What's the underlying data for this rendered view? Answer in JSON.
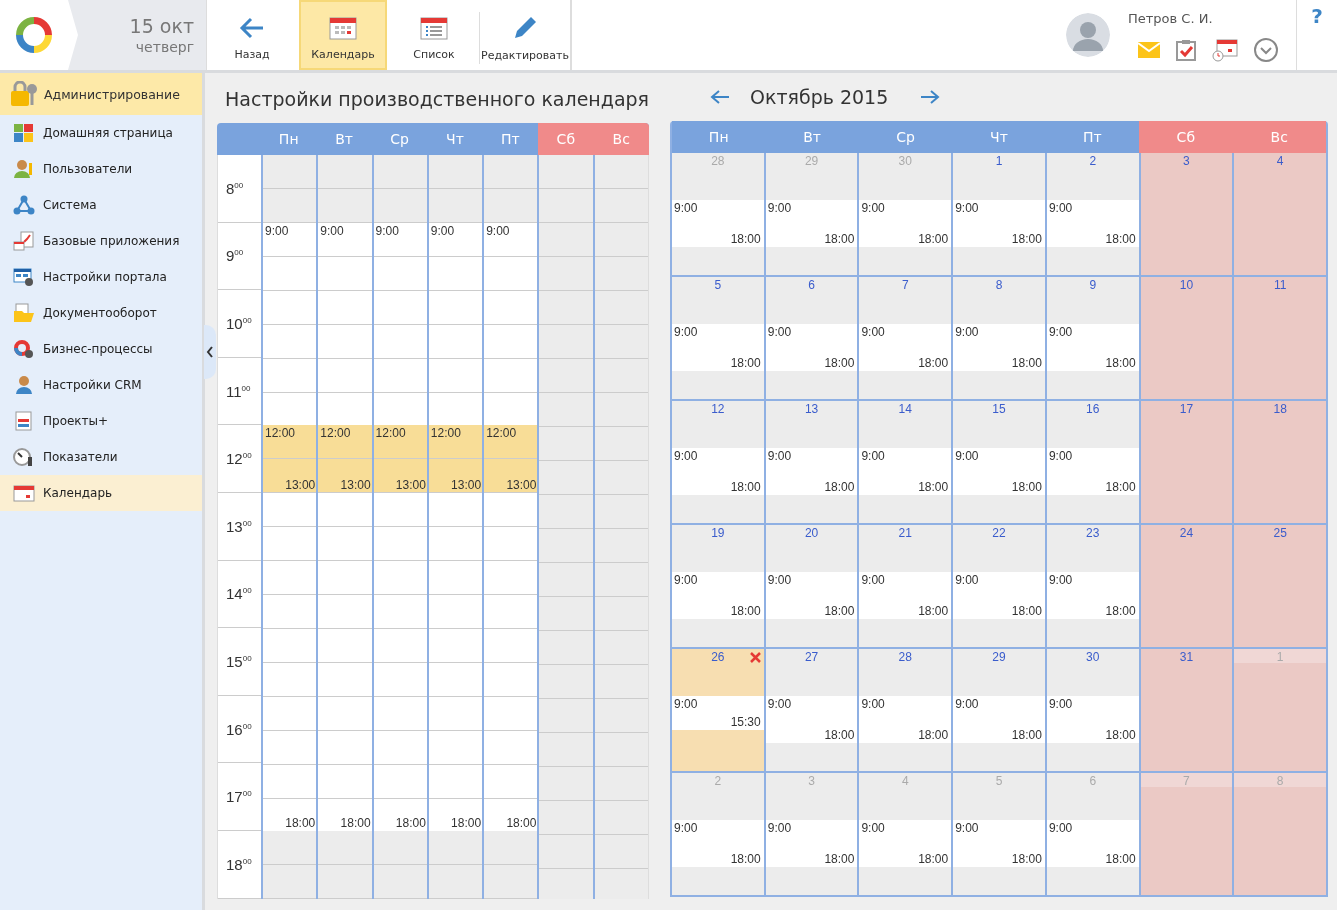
{
  "header": {
    "date": "15 окт",
    "weekday": "четверг",
    "toolbar": [
      {
        "label": "Назад",
        "kind": "back",
        "selected": false
      },
      {
        "label": "Календарь",
        "kind": "calendar",
        "selected": true
      },
      {
        "label": "Список",
        "kind": "list",
        "selected": false
      },
      {
        "label": "Редактировать",
        "kind": "edit",
        "selected": false
      }
    ],
    "user": {
      "name": "Петров С. И."
    },
    "help": "?"
  },
  "sidebar": {
    "section": {
      "label": "Администрирование"
    },
    "items": [
      {
        "label": "Домашняя страница",
        "kind": "home",
        "selected": false
      },
      {
        "label": "Пользователи",
        "kind": "users",
        "selected": false
      },
      {
        "label": "Система",
        "kind": "system",
        "selected": false
      },
      {
        "label": "Базовые приложения",
        "kind": "apps",
        "selected": false
      },
      {
        "label": "Настройки портала",
        "kind": "portal",
        "selected": false
      },
      {
        "label": "Документооборот",
        "kind": "docs",
        "selected": false
      },
      {
        "label": "Бизнес-процессы",
        "kind": "process",
        "selected": false
      },
      {
        "label": "Настройки CRM",
        "kind": "crm",
        "selected": false
      },
      {
        "label": "Проекты+",
        "kind": "projects",
        "selected": false
      },
      {
        "label": "Показатели",
        "kind": "metrics",
        "selected": false
      },
      {
        "label": "Календарь",
        "kind": "calendar",
        "selected": true
      }
    ]
  },
  "title": "Настройки производственного календаря",
  "week": {
    "hours": [
      "8$^{00}$",
      "9$^{00}$",
      "10$^{00}$",
      "11$^{00}$",
      "12$^{00}$",
      "13$^{00}$",
      "14$^{00}$",
      "15$^{00}$",
      "16$^{00}$",
      "17$^{00}$",
      "18$^{00}$"
    ],
    "days": [
      {
        "label": "Пн",
        "weekend": false,
        "start": "9:00",
        "break_start": "12:00",
        "break_end": "13:00",
        "end": "18:00"
      },
      {
        "label": "Вт",
        "weekend": false,
        "start": "9:00",
        "break_start": "12:00",
        "break_end": "13:00",
        "end": "18:00"
      },
      {
        "label": "Ср",
        "weekend": false,
        "start": "9:00",
        "break_start": "12:00",
        "break_end": "13:00",
        "end": "18:00"
      },
      {
        "label": "Чт",
        "weekend": false,
        "start": "9:00",
        "break_start": "12:00",
        "break_end": "13:00",
        "end": "18:00"
      },
      {
        "label": "Пт",
        "weekend": false,
        "start": "9:00",
        "break_start": "12:00",
        "break_end": "13:00",
        "end": "18:00"
      },
      {
        "label": "Сб",
        "weekend": true
      },
      {
        "label": "Вс",
        "weekend": true
      }
    ]
  },
  "month": {
    "title": "Октябрь 2015",
    "weekdays": [
      {
        "label": "Пн",
        "weekend": false
      },
      {
        "label": "Вт",
        "weekend": false
      },
      {
        "label": "Ср",
        "weekend": false
      },
      {
        "label": "Чт",
        "weekend": false
      },
      {
        "label": "Пт",
        "weekend": false
      },
      {
        "label": "Сб",
        "weekend": true
      },
      {
        "label": "Вс",
        "weekend": true
      }
    ],
    "weeks": [
      [
        {
          "day": "28",
          "current": false,
          "weekend": false,
          "changed": false,
          "start": "9:00",
          "end": "18:00"
        },
        {
          "day": "29",
          "current": false,
          "weekend": false,
          "changed": false,
          "start": "9:00",
          "end": "18:00"
        },
        {
          "day": "30",
          "current": false,
          "weekend": false,
          "changed": false,
          "start": "9:00",
          "end": "18:00"
        },
        {
          "day": "1",
          "current": true,
          "weekend": false,
          "changed": false,
          "start": "9:00",
          "end": "18:00"
        },
        {
          "day": "2",
          "current": true,
          "weekend": false,
          "changed": false,
          "start": "9:00",
          "end": "18:00"
        },
        {
          "day": "3",
          "current": true,
          "weekend": true,
          "changed": false
        },
        {
          "day": "4",
          "current": true,
          "weekend": true,
          "changed": false
        }
      ],
      [
        {
          "day": "5",
          "current": true,
          "weekend": false,
          "changed": false,
          "start": "9:00",
          "end": "18:00"
        },
        {
          "day": "6",
          "current": true,
          "weekend": false,
          "changed": false,
          "start": "9:00",
          "end": "18:00"
        },
        {
          "day": "7",
          "current": true,
          "weekend": false,
          "changed": false,
          "start": "9:00",
          "end": "18:00"
        },
        {
          "day": "8",
          "current": true,
          "weekend": false,
          "changed": false,
          "start": "9:00",
          "end": "18:00"
        },
        {
          "day": "9",
          "current": true,
          "weekend": false,
          "changed": false,
          "start": "9:00",
          "end": "18:00"
        },
        {
          "day": "10",
          "current": true,
          "weekend": true,
          "changed": false
        },
        {
          "day": "11",
          "current": true,
          "weekend": true,
          "changed": false
        }
      ],
      [
        {
          "day": "12",
          "current": true,
          "weekend": false,
          "changed": false,
          "start": "9:00",
          "end": "18:00"
        },
        {
          "day": "13",
          "current": true,
          "weekend": false,
          "changed": false,
          "start": "9:00",
          "end": "18:00"
        },
        {
          "day": "14",
          "current": true,
          "weekend": false,
          "changed": false,
          "start": "9:00",
          "end": "18:00"
        },
        {
          "day": "15",
          "current": true,
          "weekend": false,
          "changed": false,
          "start": "9:00",
          "end": "18:00"
        },
        {
          "day": "16",
          "current": true,
          "weekend": false,
          "changed": false,
          "start": "9:00",
          "end": "18:00"
        },
        {
          "day": "17",
          "current": true,
          "weekend": true,
          "changed": false
        },
        {
          "day": "18",
          "current": true,
          "weekend": true,
          "changed": false
        }
      ],
      [
        {
          "day": "19",
          "current": true,
          "weekend": false,
          "changed": false,
          "start": "9:00",
          "end": "18:00"
        },
        {
          "day": "20",
          "current": true,
          "weekend": false,
          "changed": false,
          "start": "9:00",
          "end": "18:00"
        },
        {
          "day": "21",
          "current": true,
          "weekend": false,
          "changed": false,
          "start": "9:00",
          "end": "18:00"
        },
        {
          "day": "22",
          "current": true,
          "weekend": false,
          "changed": false,
          "start": "9:00",
          "end": "18:00"
        },
        {
          "day": "23",
          "current": true,
          "weekend": false,
          "changed": false,
          "start": "9:00",
          "end": "18:00"
        },
        {
          "day": "24",
          "current": true,
          "weekend": true,
          "changed": false
        },
        {
          "day": "25",
          "current": true,
          "weekend": true,
          "changed": false
        }
      ],
      [
        {
          "day": "26",
          "current": true,
          "weekend": false,
          "changed": true,
          "start": "9:00",
          "end": "15:30"
        },
        {
          "day": "27",
          "current": true,
          "weekend": false,
          "changed": false,
          "start": "9:00",
          "end": "18:00"
        },
        {
          "day": "28",
          "current": true,
          "weekend": false,
          "changed": false,
          "start": "9:00",
          "end": "18:00"
        },
        {
          "day": "29",
          "current": true,
          "weekend": false,
          "changed": false,
          "start": "9:00",
          "end": "18:00"
        },
        {
          "day": "30",
          "current": true,
          "weekend": false,
          "changed": false,
          "start": "9:00",
          "end": "18:00"
        },
        {
          "day": "31",
          "current": true,
          "weekend": true,
          "changed": false
        },
        {
          "day": "1",
          "current": false,
          "weekend": true,
          "changed": false
        }
      ],
      [
        {
          "day": "2",
          "current": false,
          "weekend": false,
          "changed": false,
          "start": "9:00",
          "end": "18:00"
        },
        {
          "day": "3",
          "current": false,
          "weekend": false,
          "changed": false,
          "start": "9:00",
          "end": "18:00"
        },
        {
          "day": "4",
          "current": false,
          "weekend": false,
          "changed": false,
          "start": "9:00",
          "end": "18:00"
        },
        {
          "day": "5",
          "current": false,
          "weekend": false,
          "changed": false,
          "start": "9:00",
          "end": "18:00"
        },
        {
          "day": "6",
          "current": false,
          "weekend": false,
          "changed": false,
          "start": "9:00",
          "end": "18:00"
        },
        {
          "day": "7",
          "current": false,
          "weekend": true,
          "changed": false
        },
        {
          "day": "8",
          "current": false,
          "weekend": true,
          "changed": false
        }
      ]
    ]
  }
}
